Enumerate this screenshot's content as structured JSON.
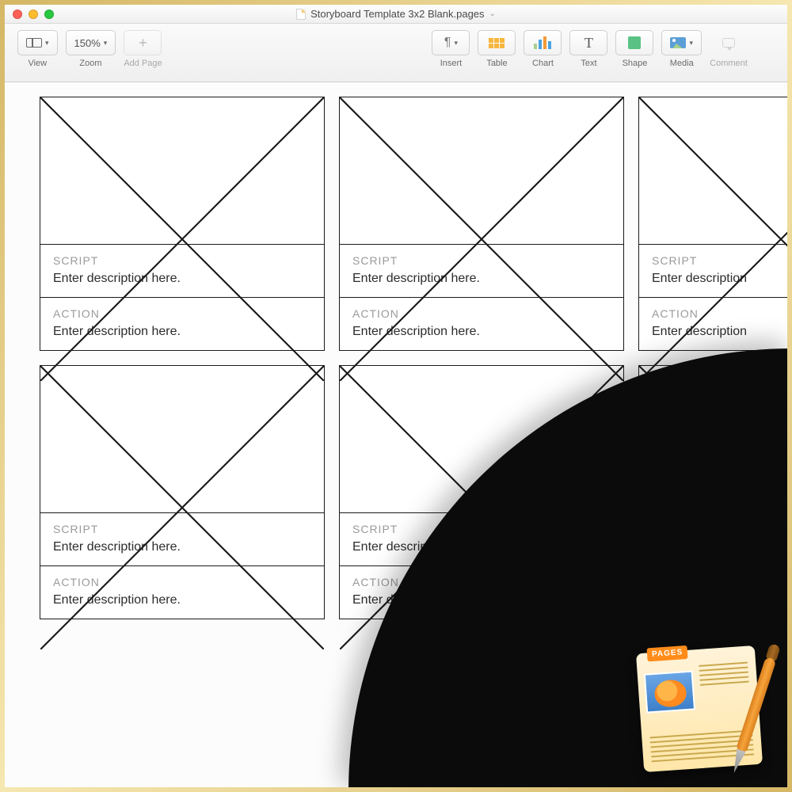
{
  "titlebar": {
    "document_name": "Storyboard Template 3x2 Blank.pages"
  },
  "toolbar": {
    "view_label": "View",
    "zoom_value": "150%",
    "zoom_label": "Zoom",
    "addpage_label": "Add Page",
    "insert_label": "Insert",
    "table_label": "Table",
    "chart_label": "Chart",
    "text_label": "Text",
    "text_glyph": "T",
    "shape_label": "Shape",
    "media_label": "Media",
    "comment_label": "Comment"
  },
  "storyboard": {
    "script_heading": "SCRIPT",
    "action_heading": "ACTION",
    "placeholder": "Enter description here.",
    "partial_placeholder": "Enter description"
  },
  "logo": {
    "badge": "PAGES"
  }
}
